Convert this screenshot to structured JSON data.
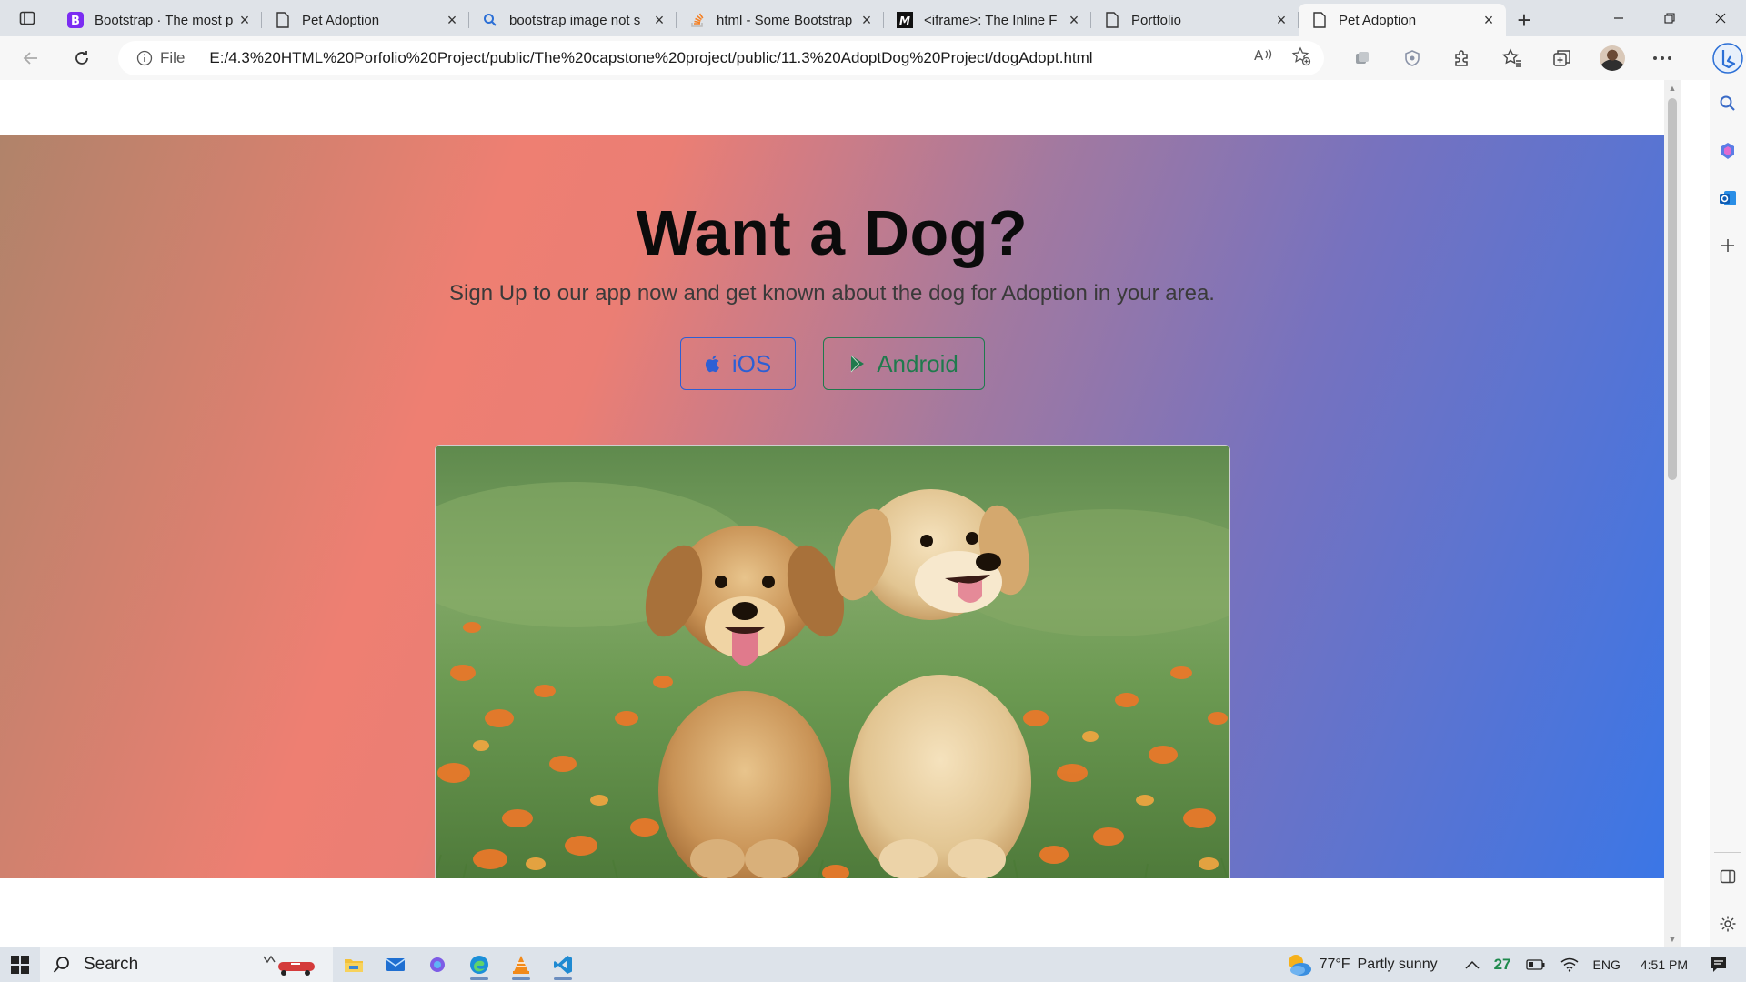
{
  "browser": {
    "tabs": [
      {
        "title": "Bootstrap · The most p",
        "favicon": "bootstrap-icon"
      },
      {
        "title": "Pet Adoption",
        "favicon": "page-icon"
      },
      {
        "title": "bootstrap image not s",
        "favicon": "search-icon"
      },
      {
        "title": "html - Some Bootstrap",
        "favicon": "stackoverflow-icon"
      },
      {
        "title": "<iframe>: The Inline F",
        "favicon": "mdn-icon"
      },
      {
        "title": "Portfolio",
        "favicon": "page-icon"
      },
      {
        "title": "Pet Adoption",
        "favicon": "page-icon",
        "active": true
      }
    ],
    "address": {
      "scheme_label": "File",
      "url": "E:/4.3%20HTML%20Porfolio%20Project/public/The%20capstone%20project/public/11.3%20AdoptDog%20Project/dogAdopt.html"
    }
  },
  "page": {
    "hero_title": "Want a Dog?",
    "hero_subtitle": "Sign Up to our app now and get known about the dog for Adoption in your area.",
    "buttons": {
      "ios_label": "iOS",
      "android_label": "Android"
    },
    "colors": {
      "ios_blue": "#2d5fd4",
      "android_green": "#1f7a4d"
    }
  },
  "taskbar": {
    "search_label": "Search",
    "weather_temp": "77°F",
    "weather_desc": "Partly sunny",
    "tray_badge": "27",
    "language": "ENG",
    "time": "4:51 PM"
  }
}
